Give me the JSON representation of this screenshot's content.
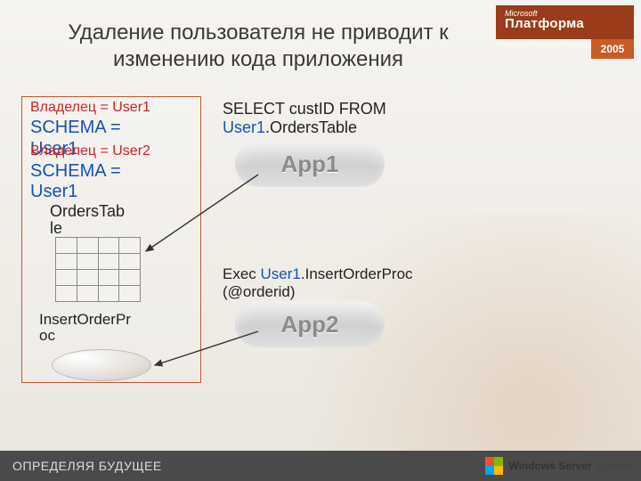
{
  "title": "Удаление пользователя не приводит к изменению кода приложения",
  "logo": {
    "small": "Microsoft",
    "big": "Платформа",
    "year": "2005"
  },
  "left": {
    "owner1_label": "Владелец = ",
    "owner1_value": "User1",
    "schema_label": "SCHEMA =",
    "schema1_value": "User1",
    "owner2_label": "Владелец = ",
    "owner2_value": "User2",
    "schema2_value": "User1",
    "table_name": "OrdersTable",
    "proc_name": "InsertOrderProc"
  },
  "right": {
    "q1_prefix": "SELECT custID FROM ",
    "q1_user": "User1",
    "q1_suffix": ".OrdersTable",
    "app1": "App1",
    "q2_prefix": "Exec ",
    "q2_user": "User1",
    "q2_suffix": ".InsertOrderProc (@orderid)",
    "app2": "App2"
  },
  "footer": {
    "tagline": "ОПРЕДЕЛЯЯ БУДУЩЕЕ",
    "brand_prefix": "Windows Server",
    "brand_suffix": "System"
  }
}
